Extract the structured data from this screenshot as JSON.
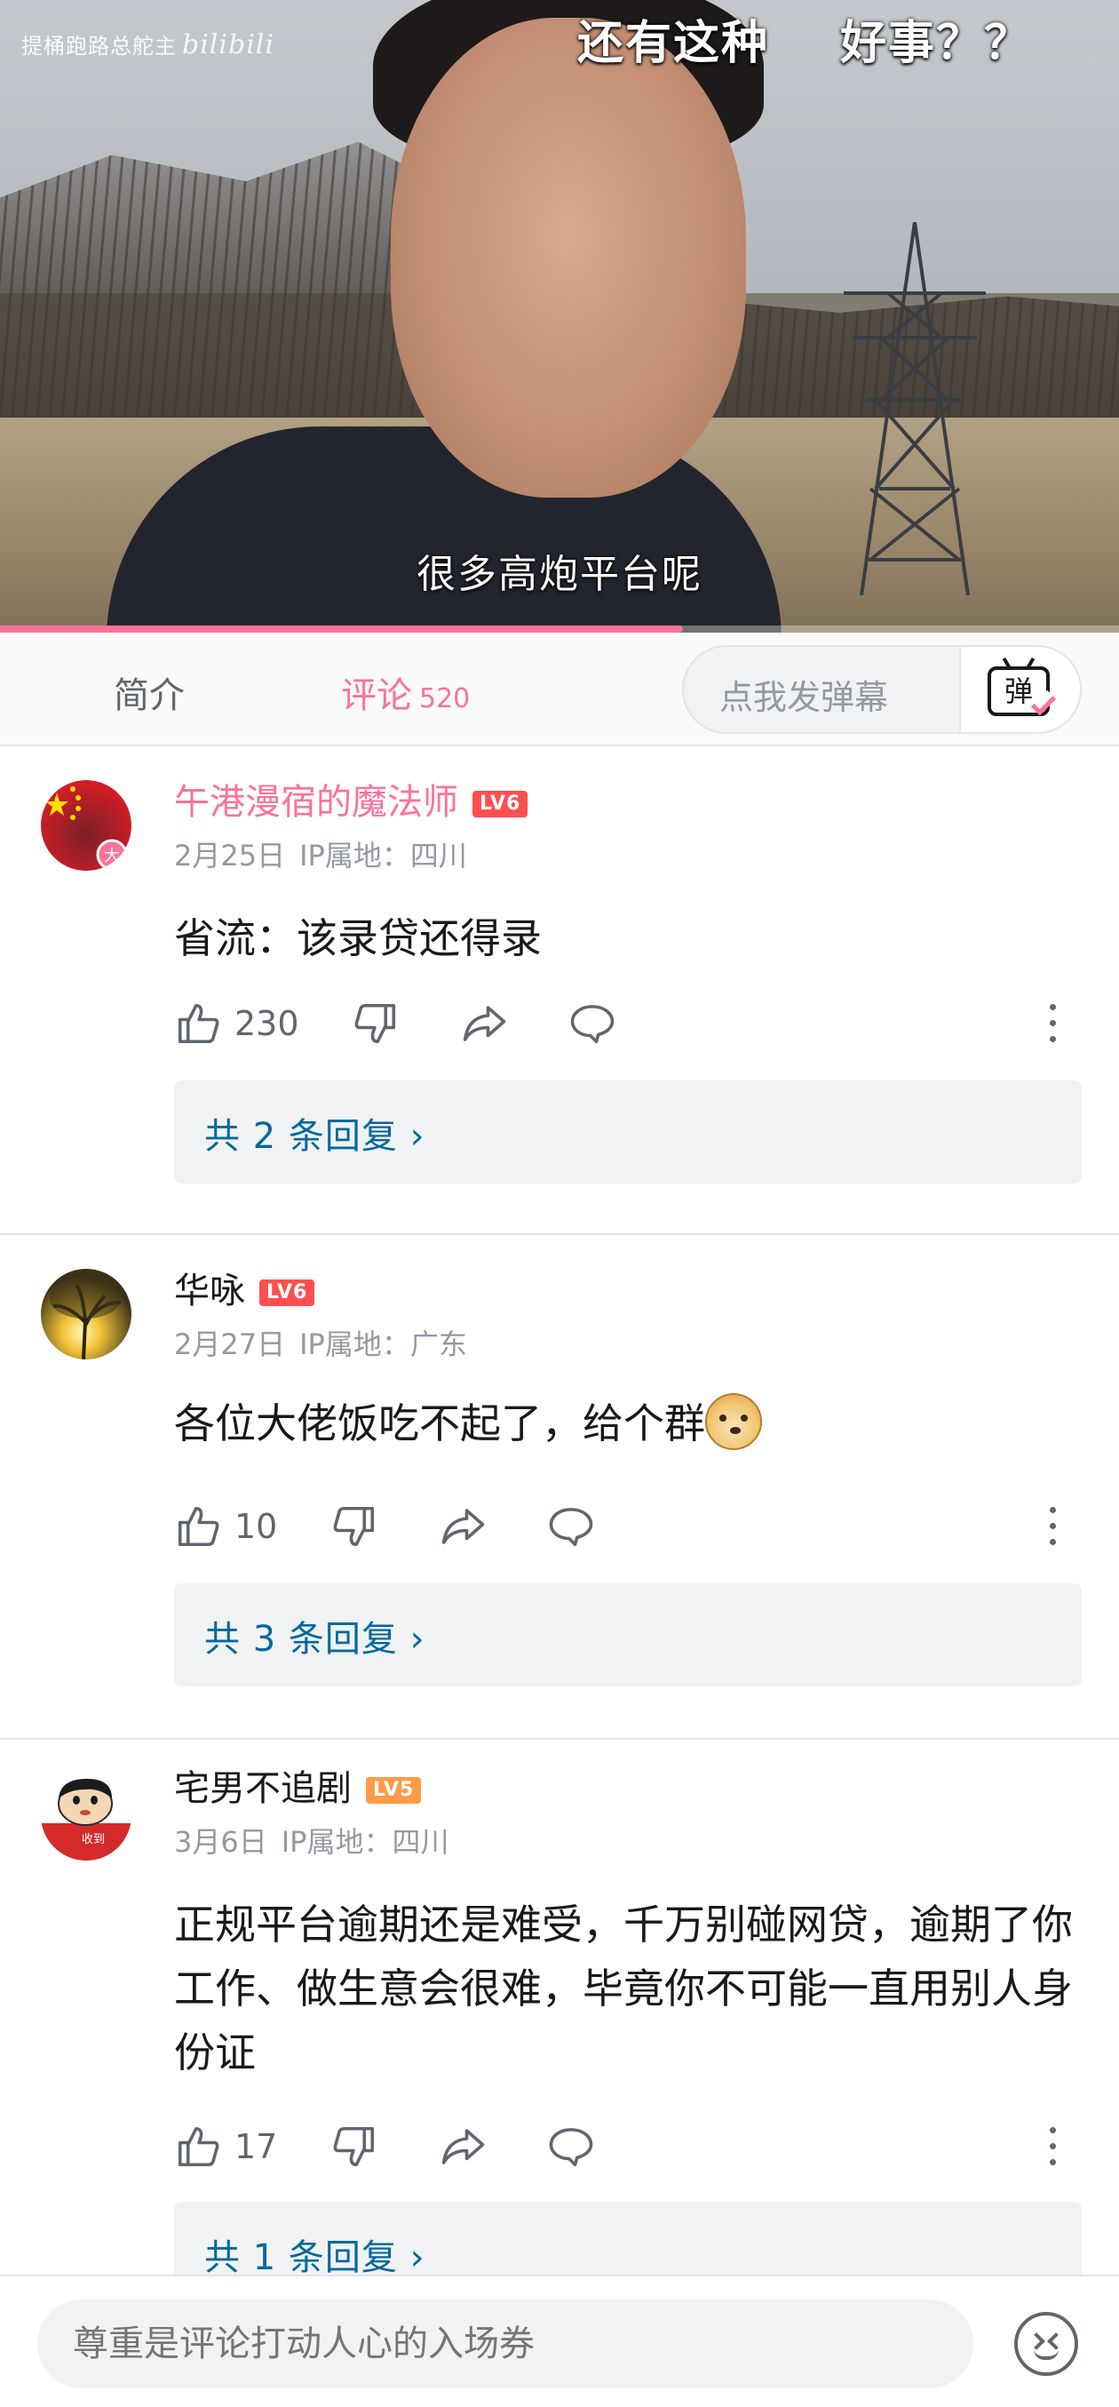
{
  "video": {
    "watermark": "提桶跑路总舵主",
    "watermark_brand": "bilibili",
    "overlay_title_1": "还有这种",
    "overlay_title_2": "好事？？",
    "subtitle": "很多高炮平台呢",
    "progress": 0.61
  },
  "tabs": {
    "intro": "简介",
    "comments": "评论",
    "comment_count": "520",
    "danmaku_placeholder": "点我发弹幕",
    "danmaku_icon_text": "弹"
  },
  "comments": [
    {
      "username": "午港漫宿的魔法师",
      "level": "LV6",
      "date": "2月25日",
      "ip": "IP属地：四川",
      "content": "省流：该录贷还得录",
      "likes": "230",
      "replies": "共 2 条回复 ›"
    },
    {
      "username": "华咏",
      "level": "LV6",
      "date": "2月27日",
      "ip": "IP属地：广东",
      "content": "各位大佬饭吃不起了，给个群",
      "likes": "10",
      "replies": "共 3 条回复 ›"
    },
    {
      "username": "宅男不追剧",
      "level": "LV5",
      "date": "3月6日",
      "ip": "IP属地：四川",
      "content": "正规平台逾期还是难受，千万别碰网贷，逾期了你工作、做生意会很难，毕竟你不可能一直用别人身份证",
      "likes": "17",
      "replies": "共 1 条回复 ›"
    }
  ],
  "bottom": {
    "input_placeholder": "尊重是评论打动人心的入场券"
  },
  "colors": {
    "brand_pink": "#fb7299",
    "link_blue": "#00699d",
    "lv6": "#ff4f4f",
    "lv5": "#ff9a47"
  }
}
